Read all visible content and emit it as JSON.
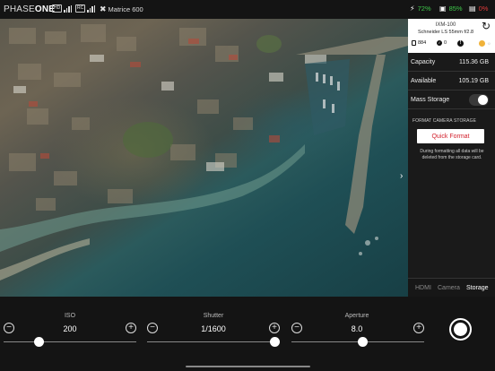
{
  "topbar": {
    "brand_left": "PHASE",
    "brand_right": "ONE",
    "hd_badge": "HD",
    "remote_badge": "RC",
    "device_name": "Matrice 600",
    "stat1_value": "72%",
    "stat2_value": "85%",
    "stat3_value": "0%",
    "colors": {
      "stat1": "#3ec84a",
      "stat2": "#3ec84a",
      "stat3": "#e23b3b"
    }
  },
  "camera": {
    "model": "IXM-100",
    "lens": "Schneider LS 55mm f/2.8",
    "card_count": "884",
    "check_count": "0"
  },
  "storage": {
    "capacity_label": "Capacity",
    "capacity_value": "115.36 GB",
    "available_label": "Available",
    "available_value": "105.19 GB",
    "mass_storage_label": "Mass Storage",
    "mass_storage_on": false,
    "format_title": "FORMAT CAMERA STORAGE",
    "quick_format_label": "Quick Format",
    "format_note": "During formatting all data will be deleted from the storage card."
  },
  "tabs": [
    "HDMI",
    "Camera",
    "Storage"
  ],
  "active_tab": "Storage",
  "controls": {
    "iso": {
      "label": "ISO",
      "value": "200",
      "slider": 0.25
    },
    "shutter": {
      "label": "Shutter",
      "value": "1/1600",
      "slider": 0.98
    },
    "aperture": {
      "label": "Aperture",
      "value": "8.0",
      "slider": 0.5
    }
  },
  "accent_colors": {
    "quick_format_text": "#d21f2b",
    "sun": "#f0b23a"
  }
}
